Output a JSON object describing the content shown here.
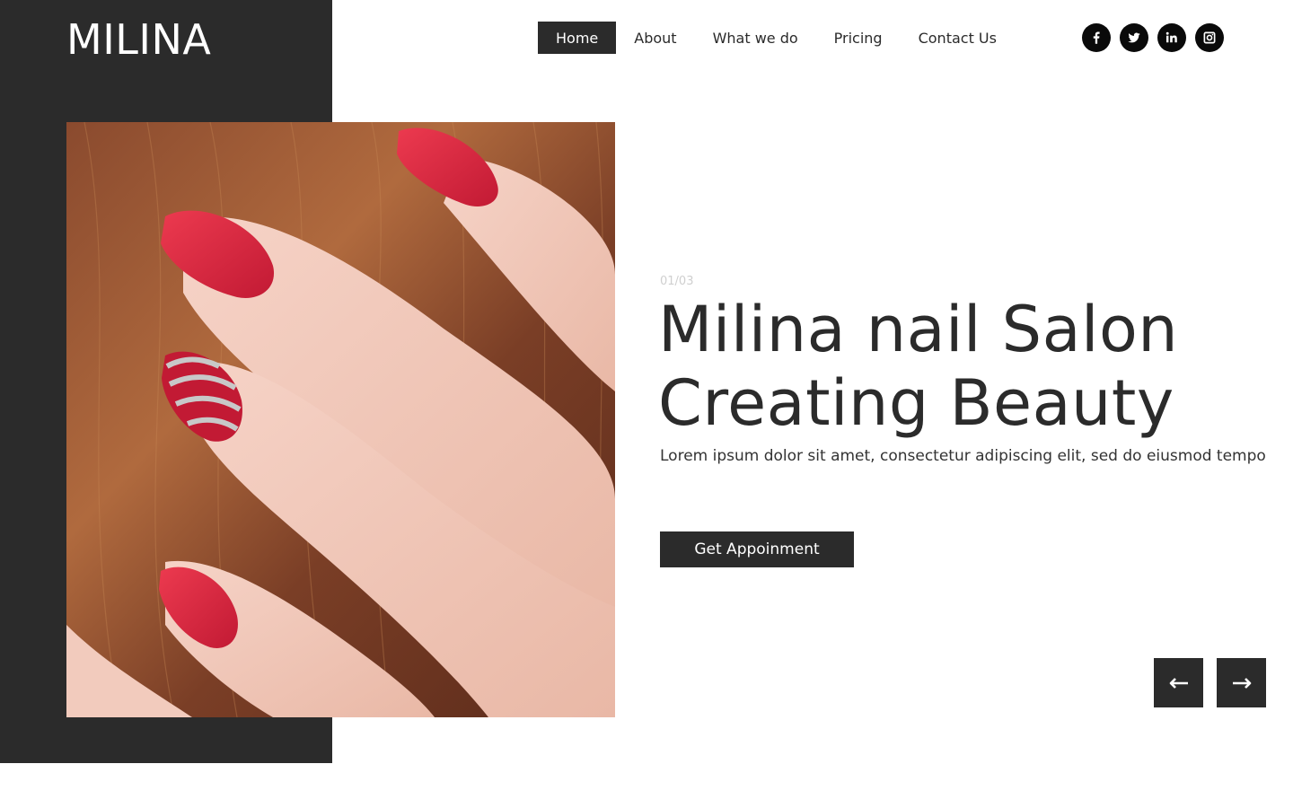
{
  "brand": {
    "logo_text": "MILINA"
  },
  "nav": {
    "items": [
      {
        "label": "Home",
        "active": true
      },
      {
        "label": "About",
        "active": false
      },
      {
        "label": "What we do",
        "active": false
      },
      {
        "label": "Pricing",
        "active": false
      },
      {
        "label": "Contact Us",
        "active": false
      }
    ]
  },
  "social": {
    "icons": [
      "facebook-icon",
      "twitter-icon",
      "linkedin-icon",
      "instagram-icon"
    ]
  },
  "hero": {
    "slide_counter": "01/03",
    "headline_line1": "Milina nail Salon",
    "headline_line2": "Creating Beauty",
    "subtitle": "Lorem ipsum dolor sit amet, consectetur adipiscing elit, sed do eiusmod tempo",
    "cta_label": "Get Appoinment",
    "image_subject": "hand-with-red-manicured-nails-in-auburn-hair",
    "prev_icon": "arrow-left-icon",
    "next_icon": "arrow-right-icon"
  },
  "colors": {
    "dark": "#2b2b2b",
    "white": "#ffffff",
    "muted": "#cfcfcf",
    "nail_red": "#d8263e"
  }
}
